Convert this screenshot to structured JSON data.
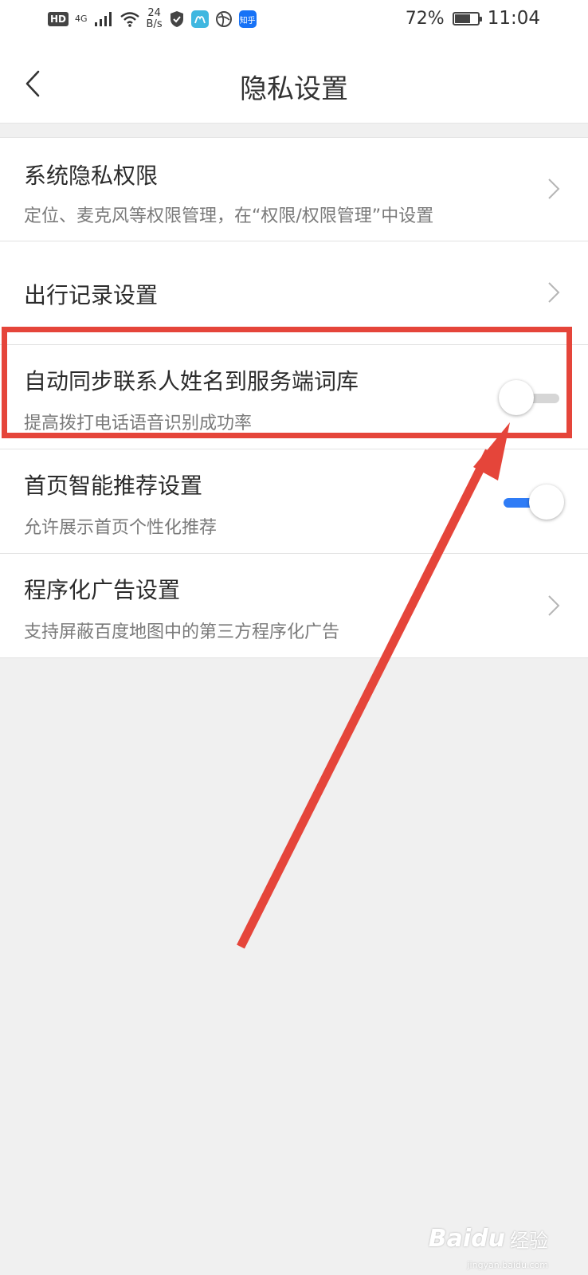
{
  "status_bar": {
    "hd_label": "HD",
    "network_label": "4G",
    "speed_value": "24",
    "speed_unit": "B/s",
    "app_icon_label": "知乎",
    "battery_percent": "72%",
    "battery_level": 0.72,
    "time": "11:04"
  },
  "header": {
    "title": "隐私设置"
  },
  "settings": {
    "items": [
      {
        "title": "系统隐私权限",
        "subtitle": "定位、麦克风等权限管理，在“权限/权限管理”中设置",
        "control": "chevron"
      },
      {
        "title": "出行记录设置",
        "subtitle": "",
        "control": "chevron"
      },
      {
        "title": "自动同步联系人姓名到服务端词库",
        "subtitle": "提高拨打电话语音识别成功率",
        "control": "toggle",
        "enabled": false
      },
      {
        "title": "首页智能推荐设置",
        "subtitle": "允许展示首页个性化推荐",
        "control": "toggle",
        "enabled": true
      },
      {
        "title": "程序化广告设置",
        "subtitle": "支持屏蔽百度地图中的第三方程序化广告",
        "control": "chevron"
      }
    ]
  },
  "colors": {
    "toggle_on": "#2f7cf6",
    "toggle_off": "#d6d6d6",
    "annotation": "#e5453a",
    "page_background": "#f0f0f0"
  },
  "watermark": {
    "logo": "Baidu",
    "text": "经验",
    "url": "jingyan.baidu.com"
  }
}
